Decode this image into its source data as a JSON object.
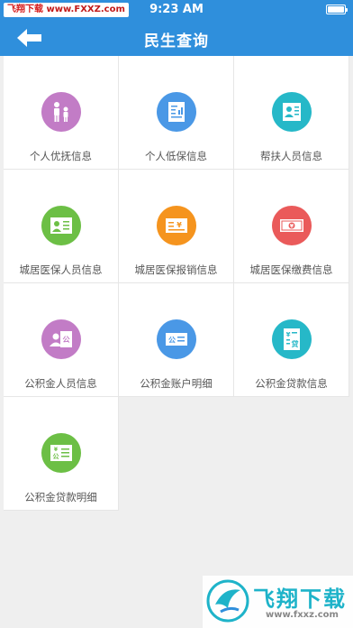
{
  "status_bar": {
    "time": "9:23 AM",
    "watermark_brand": "飞翔下载",
    "watermark_url": "www.FXXZ.com"
  },
  "nav": {
    "title": "民生查询",
    "back_icon": "back-arrow-icon"
  },
  "tiles": [
    {
      "label": "个人优抚信息",
      "color": "#c27cc6",
      "icon": "family-icon"
    },
    {
      "label": "个人低保信息",
      "color": "#4a98e6",
      "icon": "document-chart-icon"
    },
    {
      "label": "帮扶人员信息",
      "color": "#26b8c8",
      "icon": "person-list-icon"
    },
    {
      "label": "城居医保人员信息",
      "color": "#6cbf45",
      "icon": "id-card-icon"
    },
    {
      "label": "城居医保报销信息",
      "color": "#f5941e",
      "icon": "yen-receipt-icon"
    },
    {
      "label": "城居医保缴费信息",
      "color": "#ea5a5a",
      "icon": "banknote-icon"
    },
    {
      "label": "公积金人员信息",
      "color": "#c27cc6",
      "icon": "person-fund-icon"
    },
    {
      "label": "公积金账户明细",
      "color": "#4a98e6",
      "icon": "fund-card-icon"
    },
    {
      "label": "公积金贷款信息",
      "color": "#26b8c8",
      "icon": "loan-document-icon"
    },
    {
      "label": "公积金贷款明细",
      "color": "#6cbf45",
      "icon": "loan-detail-icon"
    }
  ],
  "watermark_bottom": {
    "brand": "飞翔下载",
    "url": "www.fxxz.com"
  }
}
